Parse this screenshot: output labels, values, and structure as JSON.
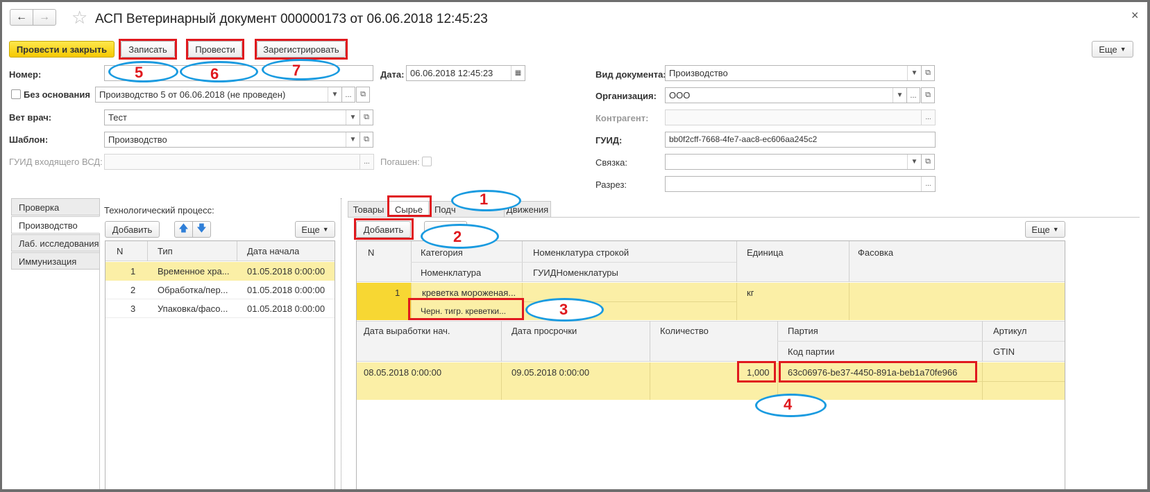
{
  "window": {
    "title": "АСП Ветеринарный документ 000000173 от 06.06.2018 12:45:23",
    "close_glyph": "×"
  },
  "nav": {
    "back": "←",
    "forward": "→",
    "star": "☆"
  },
  "toolbar": {
    "post_close": "Провести и закрыть",
    "save": "Записать",
    "post": "Провести",
    "register": "Зарегистрировать",
    "more": "Еще"
  },
  "form": {
    "number_label": "Номер:",
    "date_label": "Дата:",
    "date_value": "06.06.2018 12:45:23",
    "no_basis_label": "Без основания",
    "basis_value": "Производство 5 от 06.06.2018 (не проведен)",
    "vet_label": "Вет врач:",
    "vet_value": "Тест",
    "template_label": "Шаблон:",
    "template_value": "Производство",
    "incoming_guid_label": "ГУИД входящего ВСД:",
    "repaid_label": "Погашен:",
    "doc_type_label": "Вид документа:",
    "doc_type_value": "Производство",
    "org_label": "Организация:",
    "org_value": "ООО",
    "counterparty_label": "Контрагент:",
    "guid_label": "ГУИД:",
    "guid_value": "bb0f2cff-7668-4fe7-aac8-ec606aa245c2",
    "link_label": "Связка:",
    "section_label": "Разрез:"
  },
  "left_tabs": [
    "Проверка",
    "Производство",
    "Лаб. исследования",
    "Иммунизация"
  ],
  "process": {
    "title": "Технологический процесс:",
    "add": "Добавить",
    "more": "Еще",
    "columns": [
      "N",
      "Тип",
      "Дата начала"
    ],
    "rows": [
      {
        "n": "1",
        "type": "Временное хра...",
        "date": "01.05.2018 0:00:00"
      },
      {
        "n": "2",
        "type": "Обработка/пер...",
        "date": "01.05.2018 0:00:00"
      },
      {
        "n": "3",
        "type": "Упаковка/фасо...",
        "date": "01.05.2018 0:00:00"
      }
    ]
  },
  "right_tabs": [
    "Товары",
    "Сырье",
    "Подч",
    "Движения"
  ],
  "raw": {
    "add": "Добавить",
    "more": "Еще",
    "header": {
      "n": "N",
      "category": "Категория",
      "nomenclature": "Номенклатура",
      "nom_string": "Номенклатура строкой",
      "guid_nom": "ГУИДНоменклатуры",
      "unit": "Единица",
      "packing": "Фасовка"
    },
    "row": {
      "n": "1",
      "category": "креветка мороженая...",
      "nomenclature": "Черн. тигр. креветки...",
      "unit": "кг"
    },
    "sub_header": {
      "prod_date": "Дата выработки нач.",
      "expiry": "Дата просрочки",
      "qty": "Количество",
      "batch": "Партия",
      "batch_code": "Код партии",
      "article": "Артикул",
      "gtin": "GTIN"
    },
    "sub_row": {
      "prod_date": "08.05.2018 0:00:00",
      "expiry": "09.05.2018 0:00:00",
      "qty": "1,000",
      "batch_code": "63c06976-be37-4450-891a-beb1a70fe966"
    }
  },
  "annotations": [
    "1",
    "2",
    "3",
    "4",
    "5",
    "6",
    "7"
  ],
  "colors": {
    "accent_yellow": "#f5c800",
    "selected_row": "#fbefa6",
    "marker_red": "#e0191e",
    "marker_blue": "#1a9be0"
  }
}
